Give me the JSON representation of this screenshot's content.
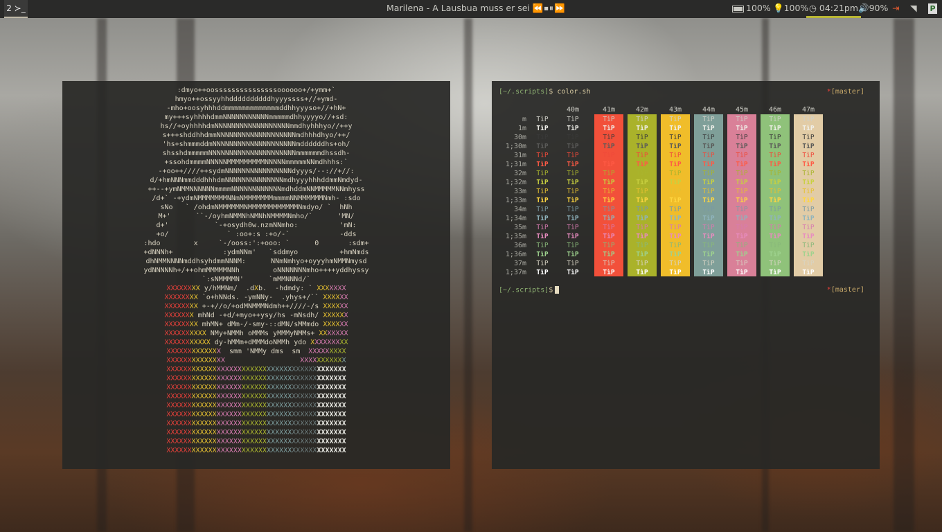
{
  "topbar": {
    "workspace": "2 ≻_",
    "media": {
      "now_playing": "Marilena - A Lausbua muss er sei",
      "controls": "⏪⏹⏸⏩"
    },
    "battery": "100%",
    "brightness": "100%",
    "time": "04:21pm",
    "volume": "90%",
    "tray_icon": "P",
    "icons": [
      "battery-icon",
      "lightbulb-icon",
      "clock-icon",
      "speaker-icon",
      "power-icon",
      "wifi-icon",
      "tray-app-icon"
    ],
    "accent": "#b8b635"
  },
  "left_terminal": {
    "art": [
      ":dmyo++oosssssssssssssssoooooo+/+ymm+`",
      "hmyo++ossyyhhddddddddddhyyyssss+//+ymd-",
      "-mho+oosyhhhddmmmmmmmmmmmmmddhhyyyso+//+hN+",
      "my+++syhhhhdmmNNNNNNNNNNNmmmmmdhhyyyyo//+sd:",
      "hs//+oyhhhhdmNNNNNNNNNNNNNNNNNNmmdhyhhhyo//++y",
      "s+++shddhhdmmNNNNNNNNNNNNNNNNNNNmdhhhdhyo/++/",
      "'hs+shmmmddmNNNNNNNNNNNNNNNNNNNNmddddddhs+oh/",
      "shsshdmmmmmNNNNNNNNNNNNNNNNNNNNNmmmmmmdhssdh-",
      "+ssohdmmmmNNNNNMMMMMMMMMNNNNNmmmmmNNmdhhhs:`",
      "-+oo++////++sydmNNNNNNNNNNNNNNNNdyyys/--://+//:",
      "d/+hmNNNmmdddhhhdmNNNNNNNNNNNNNNmdhyyyhhhddmmNmdyd-",
      "++--+ymNMMNNNNNNmmmmNNNNNNNNNNNNmdhddmNNMMMMMNNmhyss",
      "/d+` -+ydmNMMMMMMMNNmNMMMMMMMmmmmNNMMMMMMNmh- :sdo",
      "sNo   ` /ohdmNMMMMMMNMMMMMMMMMMMMNmdyo/ `  hNh",
      "M+'      ``-/oyhmNMMNhNMNhNMMMMNmho/`      'MN/",
      "d+'           `-+osydh0w.nzmNNmho:          'mN:",
      "+o/              ` :oo+:s :+o/-`            -dds",
      ":hdo        x     `-/ooss:':+ooo: `      0       :sdm+",
      "+dNNNh+            :ydmNNm'   `sddmyo          +hmNmds",
      "dhNMMNNNNmddhsyhdmmNNNM:      NNmNmhyo+oyyyhmNMMNmysd",
      "ydNNNNNh+/++ohmMMMMMNNh        oNNNNNNNmho++++yddhyssy",
      "`:sNMMMMN'      `mMMNNNd/`",
      "XXXXXXXX y/hMMNm/  .dXb.  -hdmdy: ` XXXXXXX",
      "XXXXXXXX `o+hNNds. -ymNNy-  .yhys+/`` XXXXXX",
      "XXXXXXXX +-+//o/+odMNMMMNdmh++////-/s XXXXXX",
      "XXXXXXX mhNd -+d/+myo++ysy/hs -mNsdh/ XXXXXX",
      "XXXXXXXX mhMN+ dMm-/-smy-::dMN/sMMmdo XXXXXX",
      "XXXXXXXXXX NMy+NMMh oMMMs yMMMyNMMs+ XXXXXXX",
      "XXXXXXXXXXX dy-hMMm+dMMMdoNMMh ydo XXXXXXXXX",
      "XXXXXXXXXXXXX  smm 'NMMy dms  sm  XXXXXXXXX",
      "XXXXXXXXXXXXXX                  XXXXXXXXXXX",
      "XXXXXXXXXXXXXXXXXXXXXXXXXXXXXXXXXXXXXXXXXXX"
    ]
  },
  "right_terminal": {
    "prompt_path": "[~/.scripts]",
    "prompt_sym": "$",
    "command": "color.sh",
    "branch": "[master]",
    "branch_marker": "*",
    "sample": "TìP",
    "bg_headers": [
      "40m",
      "41m",
      "42m",
      "43m",
      "44m",
      "45m",
      "46m",
      "47m"
    ],
    "bg_colors": [
      "",
      "#f2503a",
      "#aab22a",
      "#f0bd2a",
      "#7f9f99",
      "#d98098",
      "#8fc27a",
      "#e2ccA6"
    ],
    "rows": [
      "m",
      "1m",
      "30m",
      "1;30m",
      "31m",
      "1;31m",
      "32m",
      "1;32m",
      "33m",
      "1;33m",
      "34m",
      "1;34m",
      "35m",
      "1;35m",
      "36m",
      "1;36m",
      "37m",
      "1;37m"
    ],
    "fg_colors": [
      "#d0d0c8",
      "#f0f0ea",
      "#3a3a3a",
      "#5a5a58",
      "#ef4a3a",
      "#ff5a45",
      "#a9b42e",
      "#c8d040",
      "#e6c030",
      "#ffd640",
      "#7a9aa4",
      "#8fb4bd",
      "#d77bb0",
      "#e88cc0",
      "#89b87a",
      "#9ed28e",
      "#d8d4c4",
      "#ffffff"
    ]
  }
}
